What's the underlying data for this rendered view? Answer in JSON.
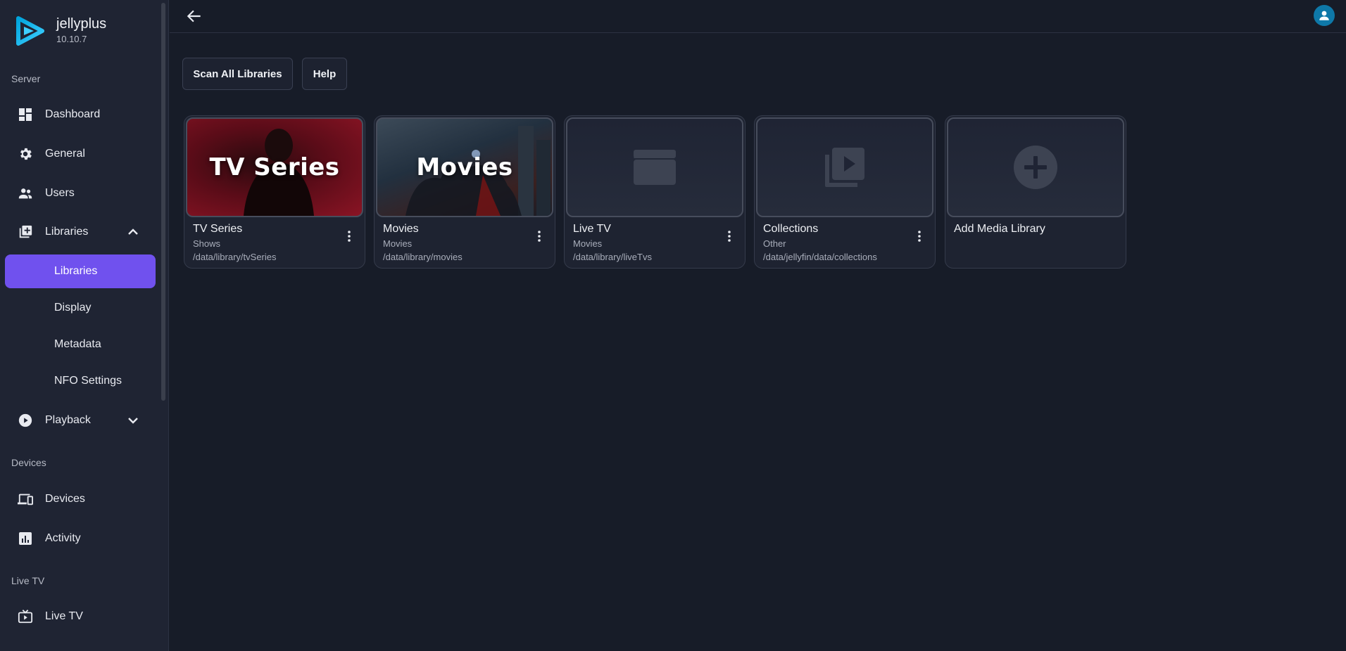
{
  "app": {
    "name": "jellyplus",
    "version": "10.10.7"
  },
  "sidebar": {
    "sections": {
      "server": "Server",
      "devices": "Devices",
      "livetv": "Live TV"
    },
    "items": {
      "dashboard": "Dashboard",
      "general": "General",
      "users": "Users",
      "libraries": "Libraries",
      "libraries_sub": "Libraries",
      "display": "Display",
      "metadata": "Metadata",
      "nfo": "NFO Settings",
      "playback": "Playback",
      "devices": "Devices",
      "activity": "Activity",
      "livetv": "Live TV"
    }
  },
  "actions": {
    "scan": "Scan All Libraries",
    "help": "Help"
  },
  "libraries": [
    {
      "name": "TV Series",
      "type": "Shows",
      "path": "/data/library/tvSeries",
      "overlay": "TV Series",
      "icon": "tv-series-poster"
    },
    {
      "name": "Movies",
      "type": "Movies",
      "path": "/data/library/movies",
      "overlay": "Movies",
      "icon": "movies-poster"
    },
    {
      "name": "Live TV",
      "type": "Movies",
      "path": "/data/library/liveTvs",
      "icon": "clapperboard-icon"
    },
    {
      "name": "Collections",
      "type": "Other",
      "path": "/data/jellyfin/data/collections",
      "icon": "collections-icon"
    }
  ],
  "add_library": {
    "label": "Add Media Library",
    "icon": "add-circle-icon"
  },
  "colors": {
    "accent": "#7051ee",
    "background": "#171c28",
    "sidebar": "#1f2433",
    "avatar": "#0e78a8"
  }
}
